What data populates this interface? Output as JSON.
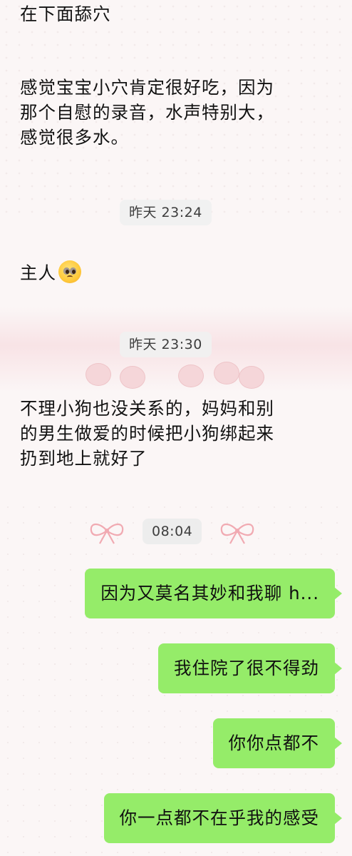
{
  "incoming": [
    {
      "lines": [
        "在下面舔穴"
      ]
    },
    {
      "lines": [
        "感觉宝宝小穴肯定很好吃，因为",
        "那个自慰的录音，水声特别大，",
        "感觉很多水。"
      ]
    },
    {
      "lines": [
        "主人"
      ],
      "emoji": "pleading-face-emoji"
    },
    {
      "lines": [
        "不理小狗也没关系的，妈妈和别",
        "的男生做爱的时候把小狗绑起来",
        "扔到地上就好了"
      ]
    }
  ],
  "timestamps": [
    "昨天 23:24",
    "昨天 23:30",
    "08:04"
  ],
  "outgoing": [
    "因为又莫名其妙和我聊 h...",
    "我住院了很不得劲",
    "你你点都不",
    "你一点都不在乎我的感受"
  ],
  "colors": {
    "outgoing_bubble": "#95ec69",
    "background": "#fbf6f6",
    "time_pill": "#f0f0f0"
  },
  "icons": [
    "bow-icon-left",
    "bow-icon-right"
  ]
}
